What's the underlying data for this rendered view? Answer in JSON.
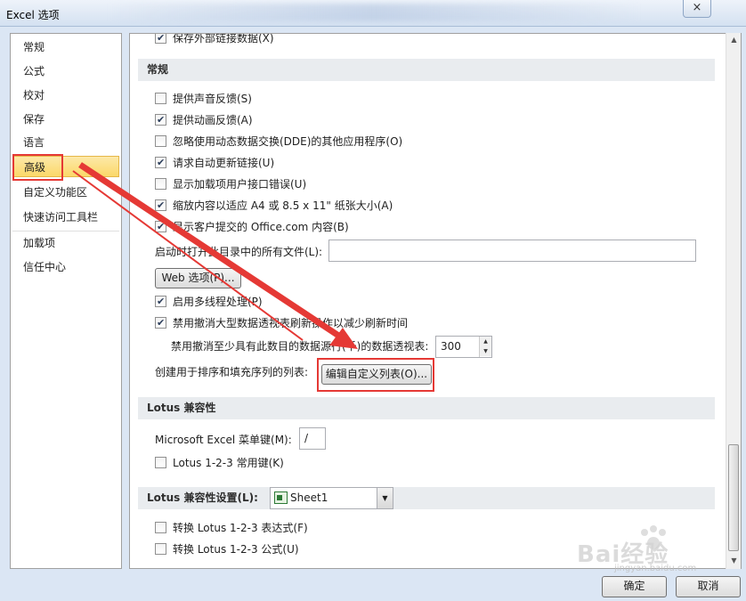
{
  "window": {
    "title": "Excel 选项",
    "close_glyph": "×"
  },
  "nav": {
    "items": [
      {
        "label": "常规"
      },
      {
        "label": "公式"
      },
      {
        "label": "校对"
      },
      {
        "label": "保存"
      },
      {
        "label": "语言"
      },
      {
        "label": "高级",
        "selected": true
      },
      {
        "label": "自定义功能区"
      },
      {
        "label": "快速访问工具栏"
      },
      {
        "label": "加载项"
      },
      {
        "label": "信任中心"
      }
    ]
  },
  "top_cutoff_option": {
    "label": "保存外部链接数据(X)",
    "checked": true
  },
  "general": {
    "header": "常规",
    "options": [
      {
        "label": "提供声音反馈(S)",
        "checked": false
      },
      {
        "label": "提供动画反馈(A)",
        "checked": true
      },
      {
        "label": "忽略使用动态数据交换(DDE)的其他应用程序(O)",
        "checked": false
      },
      {
        "label": "请求自动更新链接(U)",
        "checked": true
      },
      {
        "label": "显示加载项用户接口错误(U)",
        "checked": false
      },
      {
        "label": "缩放内容以适应 A4 或 8.5 x 11\" 纸张大小(A)",
        "checked": true
      },
      {
        "label": "显示客户提交的 Office.com 内容(B)",
        "checked": true
      }
    ],
    "startup_label": "启动时打开此目录中的所有文件(L):",
    "startup_value": "",
    "web_options_button": "Web 选项(P)...",
    "multithread": {
      "label": "启用多线程处理(P)",
      "checked": true
    },
    "undo_large": {
      "label": "禁用撤消大型数据透视表刷新操作以减少刷新时间",
      "checked": true
    },
    "undo_rows_label": "禁用撤消至少具有此数目的数据源行(千)的数据透视表:",
    "undo_rows_value": "300",
    "custom_list_label": "创建用于排序和填充序列的列表:",
    "custom_list_button": "编辑自定义列表(O)..."
  },
  "lotus": {
    "header": "Lotus 兼容性",
    "menu_key_label": "Microsoft Excel 菜单键(M):",
    "menu_key_value": "/",
    "nav_keys": {
      "label": "Lotus 1-2-3 常用键(K)",
      "checked": false
    }
  },
  "lotus_settings": {
    "header": "Lotus 兼容性设置(L):",
    "sheet_value": "Sheet1",
    "options": [
      {
        "label": "转换 Lotus 1-2-3 表达式(F)",
        "checked": false
      },
      {
        "label": "转换 Lotus 1-2-3 公式(U)",
        "checked": false
      }
    ]
  },
  "footer": {
    "ok": "确定",
    "cancel": "取消"
  },
  "watermark": {
    "text": "Bai经验",
    "sub": "jingyan.baidu.com"
  },
  "annotation_color": "#e53935"
}
